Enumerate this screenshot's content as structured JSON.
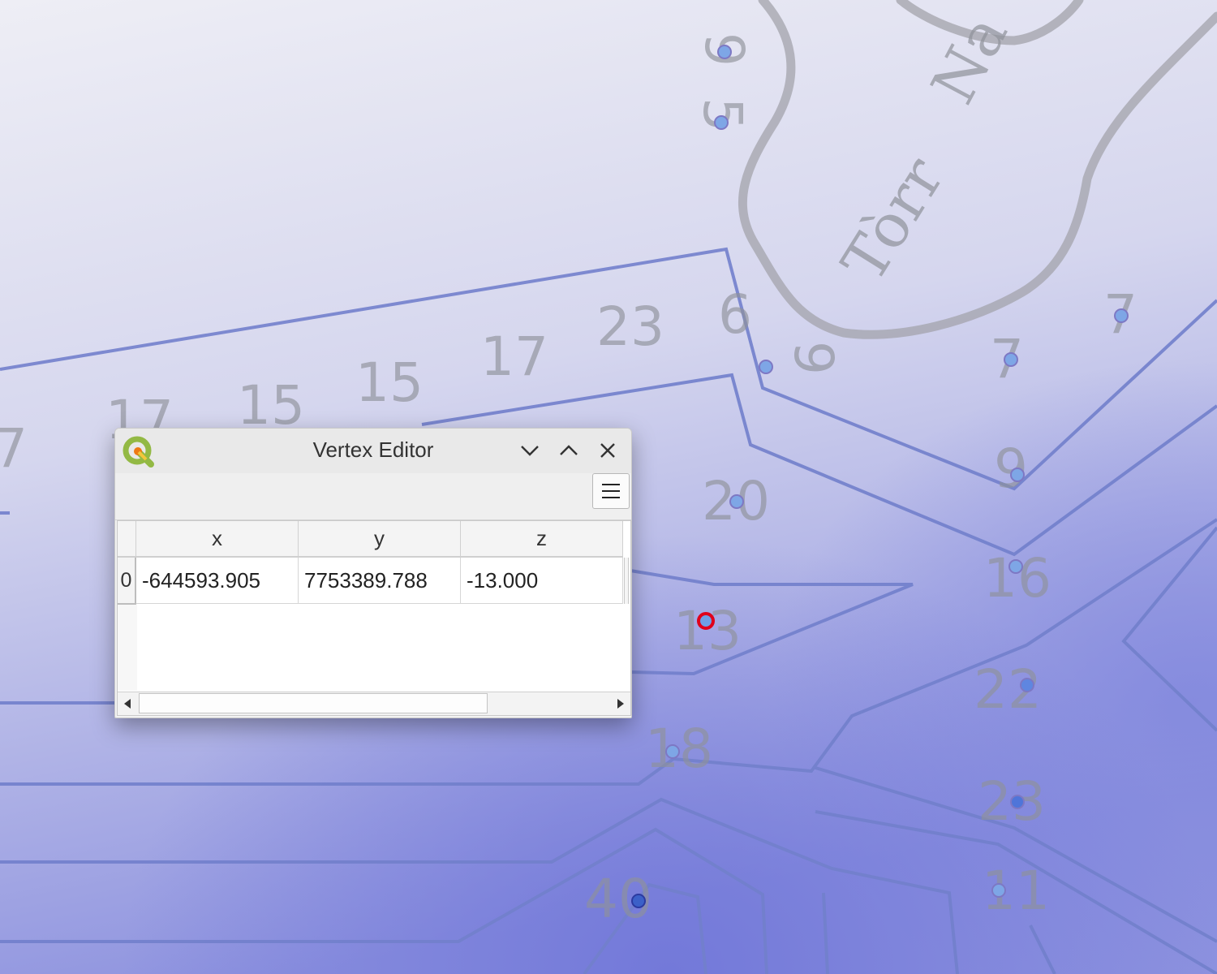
{
  "window": {
    "title": "Vertex Editor",
    "icon": "qgis-logo-icon",
    "controls": [
      "minimize-icon",
      "maximize-icon",
      "close-icon"
    ],
    "menu_icon": "hamburger-menu-icon"
  },
  "table": {
    "columns": [
      "x",
      "y",
      "z"
    ],
    "rows": [
      {
        "index": "0",
        "x": "-644593.905",
        "y": "7753389.788",
        "z": "-13.000"
      }
    ]
  },
  "map": {
    "depth_labels": [
      "9",
      "5",
      "6",
      "9",
      "7",
      "7",
      "9",
      "23",
      "17",
      "15",
      "15",
      "7",
      "17",
      "20",
      "16",
      "13",
      "22",
      "18",
      "23",
      "11",
      "40"
    ],
    "place_label": "Tòrr",
    "fill_color": "#7d82dc",
    "line_color": "#6f7cc9",
    "selected_vertex_color": "#e0001b"
  }
}
